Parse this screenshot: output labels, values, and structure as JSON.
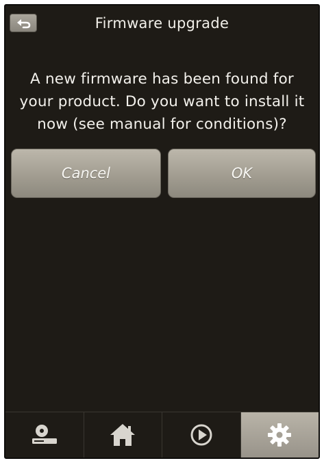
{
  "header": {
    "title": "Firmware upgrade",
    "back_icon": "back-arrow-icon"
  },
  "dialog": {
    "message": "A new firmware has been found for your product. Do you want to install it now (see manual for conditions)?",
    "cancel_label": "Cancel",
    "ok_label": "OK"
  },
  "tabbar": {
    "tabs": [
      {
        "icon": "disc-player-icon",
        "active": false
      },
      {
        "icon": "home-icon",
        "active": false
      },
      {
        "icon": "play-icon",
        "active": false
      },
      {
        "icon": "gear-icon",
        "active": true
      }
    ]
  },
  "colors": {
    "background": "#1e1b16",
    "button": "#a29d91",
    "text": "#f3f1ec"
  }
}
